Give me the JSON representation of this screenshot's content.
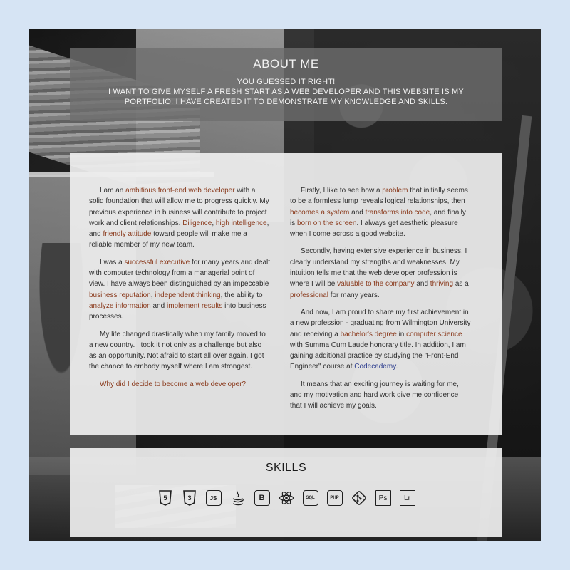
{
  "about": {
    "title": "ABOUT ME",
    "subtitle_line1": "YOU GUESSED IT RIGHT!",
    "subtitle_line2": "I WANT TO GIVE MYSELF A FRESH START AS A WEB DEVELOPER AND THIS WEBSITE IS MY PORTFOLIO. I HAVE CREATED IT TO DEMONSTRATE MY KNOWLEDGE AND SKILLS."
  },
  "left": {
    "p1": {
      "a": "I am an ",
      "b": "ambitious front-end web developer",
      "c": " with a solid foundation that will allow me to progress quickly. My previous experience in business will contribute to project work and client relationships. ",
      "d": "Diligence",
      "e": ", ",
      "f": "high intelligence",
      "g": ", and ",
      "h": "friendly attitude",
      "i": " toward people will make me a reliable member of my new team."
    },
    "p2": {
      "a": "I was a ",
      "b": "successful executive",
      "c": " for many years and dealt with computer technology from a managerial point of view. I have always been distinguished by an impeccable ",
      "d": "business reputation",
      "e": ", ",
      "f": "independent thinking",
      "g": ", the ability to ",
      "h": "analyze information",
      "i": " and ",
      "j": "implement results",
      "k": " into business processes."
    },
    "p3": "My life changed drastically when my family moved to a new country. I took it not only as a challenge but also as an opportunity. Not afraid to start all over again, I got the chance to embody myself where I am strongest.",
    "p4": "Why did I decide to become a web developer?"
  },
  "right": {
    "p1": {
      "a": "Firstly, I like to see how a ",
      "b": "problem",
      "c": " that initially seems to be a formless lump reveals logical relationships, then ",
      "d": "becomes a system",
      "e": " and ",
      "f": "transforms into code",
      "g": ", and finally is ",
      "h": "born on the screen",
      "i": ". I always get aesthetic pleasure when I come across a good website."
    },
    "p2": {
      "a": "Secondly, having extensive experience in business, I clearly understand my strengths and weaknesses. My intuition tells me that the web developer profession is where I will be ",
      "b": "valuable to the company",
      "c": " and ",
      "d": "thriving",
      "e": " as a ",
      "f": "professional",
      "g": " for many years."
    },
    "p3": {
      "a": "And now, I am proud to share my first achievement in a new profession - graduating from Wilmington University and receiving a ",
      "b": "bachelor's degree",
      "c": " in ",
      "d": "computer science",
      "e": " with Summa Cum Laude honorary title. In addition, I am gaining additional practice by studying the \"Front-End Engineer\" course at ",
      "f": "Codecademy",
      "g": "."
    },
    "p4": "It means that an exciting journey is waiting for me, and my motivation and hard work give me confidence that I will achieve my goals."
  },
  "skills": {
    "title": "SKILLS",
    "icons": [
      {
        "name": "html5-icon",
        "label": "5"
      },
      {
        "name": "css3-icon",
        "label": "3"
      },
      {
        "name": "javascript-icon",
        "label": "JS"
      },
      {
        "name": "java-icon",
        "label": ""
      },
      {
        "name": "bootstrap-icon",
        "label": "B"
      },
      {
        "name": "react-icon",
        "label": ""
      },
      {
        "name": "sql-icon",
        "label": "SQL"
      },
      {
        "name": "php-icon",
        "label": "PHP"
      },
      {
        "name": "git-icon",
        "label": ""
      },
      {
        "name": "photoshop-icon",
        "label": "Ps"
      },
      {
        "name": "lightroom-icon",
        "label": "Lr"
      }
    ]
  },
  "colors": {
    "highlight": "#8a3a1c",
    "link": "#2f3f8f",
    "page_bg": "#d6e4f4"
  }
}
